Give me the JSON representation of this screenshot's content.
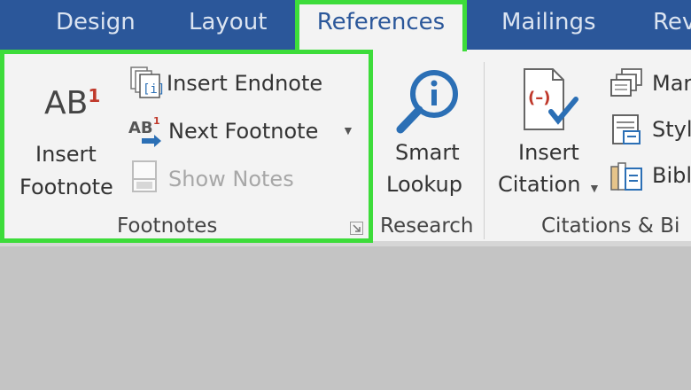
{
  "tabs": [
    {
      "label": "Design"
    },
    {
      "label": "Layout"
    },
    {
      "label": "References"
    },
    {
      "label": "Mailings"
    },
    {
      "label": "Rev"
    }
  ],
  "footnotes_group": {
    "insert_footnote": {
      "line1": "Insert",
      "line2": "Footnote",
      "icon_text": "AB",
      "icon_sup": "1"
    },
    "insert_endnote": "Insert Endnote",
    "next_footnote": "Next Footnote",
    "next_footnote_icon_text": "AB",
    "show_notes": "Show Notes",
    "group_label": "Footnotes"
  },
  "research_group": {
    "smart_lookup": {
      "line1": "Smart",
      "line2": "Lookup"
    },
    "group_label": "Research"
  },
  "citations_group": {
    "insert_citation": {
      "line1": "Insert",
      "line2": "Citation"
    },
    "manage": "Mar",
    "style": "Styl",
    "bibliography": "Bibl",
    "group_label": "Citations & Bi"
  },
  "colors": {
    "tab_bar": "#2b579a",
    "ribbon": "#f3f3f3",
    "highlight": "#3ddc3a",
    "footnote_red": "#c0392b"
  }
}
